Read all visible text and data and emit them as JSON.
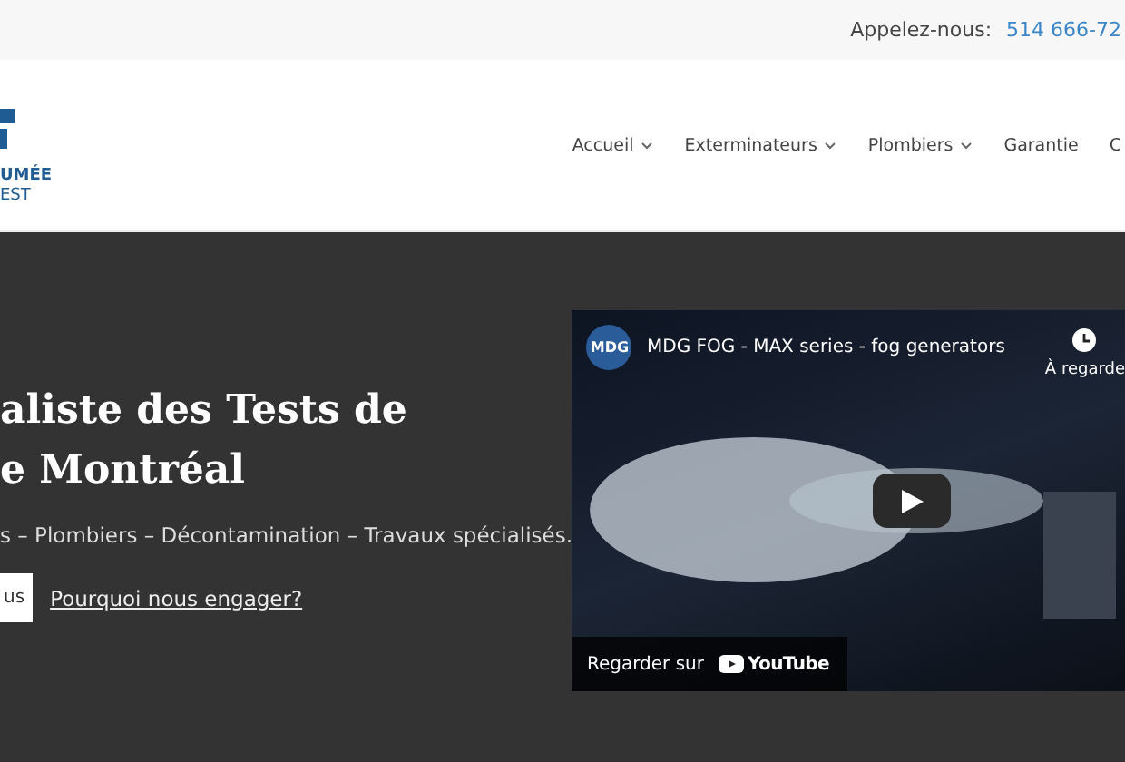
{
  "top_bar": {
    "label": "Appelez-nous:",
    "phone": "514 666-72"
  },
  "logo": {
    "line_1": "UMÉE",
    "line_2": "EST"
  },
  "nav": [
    {
      "label": "Accueil",
      "dropdown": true
    },
    {
      "label": "Exterminateurs",
      "dropdown": true
    },
    {
      "label": "Plombiers",
      "dropdown": true
    },
    {
      "label": "Garantie",
      "dropdown": false
    },
    {
      "label": "C",
      "dropdown": false
    }
  ],
  "hero": {
    "title_lines": [
      "aliste des Tests de",
      "e Montréal"
    ],
    "subtitle": "s – Plombiers – Décontamination – Travaux spécialisés.",
    "primary_button": "us",
    "link": "Pourquoi nous engager?"
  },
  "video": {
    "channel": "MDG",
    "title": "MDG FOG - MAX series - fog generators",
    "watch_later": "À regarde",
    "watch_on": "Regarder sur",
    "platform": "YouTube"
  }
}
